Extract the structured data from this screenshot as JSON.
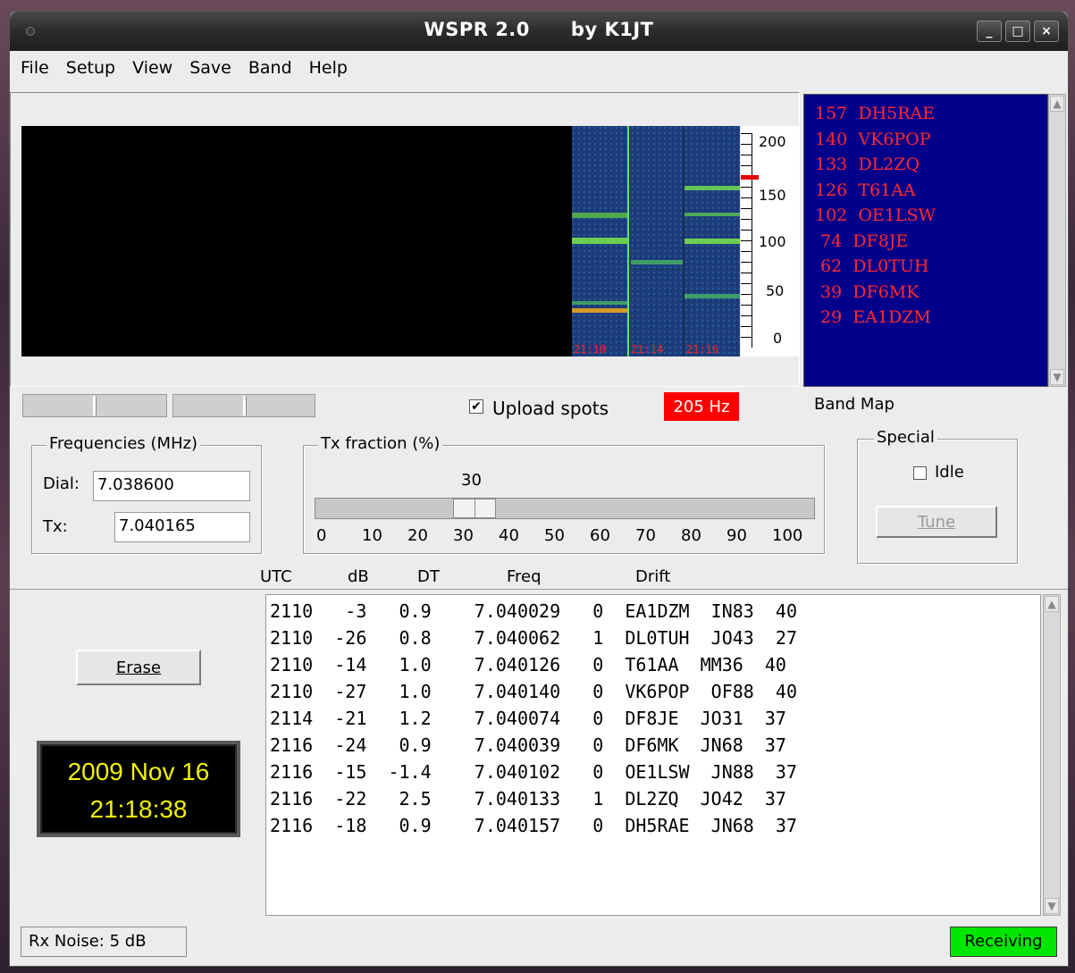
{
  "window": {
    "title": "WSPR 2.0",
    "title_by": "by K1JT",
    "buttons": {
      "minimize": "_",
      "maximize": "□",
      "close": "×"
    }
  },
  "menu": [
    "File",
    "Setup",
    "View",
    "Save",
    "Band",
    "Help"
  ],
  "waterfall": {
    "time_labels": [
      "21:10",
      "21:14",
      "21:16"
    ],
    "scale_labels": [
      "200",
      "150",
      "100",
      "50",
      "0"
    ]
  },
  "band_map": {
    "label": "Band Map",
    "entries": [
      "157  DH5RAE",
      "140  VK6POP",
      "133  DL2ZQ",
      "126  T61AA",
      "102  OE1LSW",
      " 74  DF8JE",
      " 62  DL0TUH",
      " 39  DF6MK",
      " 29  EA1DZM"
    ]
  },
  "controls": {
    "upload_spots_label": "Upload spots",
    "upload_spots_checked": true,
    "freq_offset": "205 Hz"
  },
  "frequencies": {
    "title": "Frequencies (MHz)",
    "dial_label": "Dial:",
    "dial_value": "7.038600",
    "tx_label": "Tx:",
    "tx_value": "7.040165"
  },
  "tx_fraction": {
    "title": "Tx fraction (%)",
    "value": "30",
    "ticks": [
      "0",
      "10",
      "20",
      "30",
      "40",
      "50",
      "60",
      "70",
      "80",
      "90",
      "100"
    ]
  },
  "special": {
    "title": "Special",
    "idle_label": "Idle",
    "idle_checked": false,
    "tune_label": "Tune"
  },
  "decodes": {
    "headers": {
      "utc": "UTC",
      "db": "dB",
      "dt": "DT",
      "freq": "Freq",
      "drift": "Drift"
    },
    "rows": [
      "2110   -3   0.9    7.040029   0  EA1DZM  IN83  40",
      "2110  -26   0.8    7.040062   1  DL0TUH  JO43  27",
      "2110  -14   1.0    7.040126   0  T61AA  MM36  40",
      "2110  -27   1.0    7.040140   0  VK6POP  OF88  40",
      "2114  -21   1.2    7.040074   0  DF8JE  JO31  37",
      "2116  -24   0.9    7.040039   0  DF6MK  JN68  37",
      "2116  -15  -1.4    7.040102   0  OE1LSW  JN88  37",
      "2116  -22   2.5    7.040133   1  DL2ZQ  JO42  37",
      "2116  -18   0.9    7.040157   0  DH5RAE  JN68  37"
    ]
  },
  "erase_label": "Erase",
  "clock": {
    "date": "2009 Nov 16",
    "time": "21:18:38"
  },
  "status": {
    "rx_noise": "Rx Noise: 5 dB",
    "state": "Receiving"
  },
  "colors": {
    "band_map_bg": "#00008b",
    "band_map_text": "#ff2b2b",
    "offset_bg": "#ff0000",
    "receiving_bg": "#00e600",
    "clock_text": "#f2f200"
  }
}
